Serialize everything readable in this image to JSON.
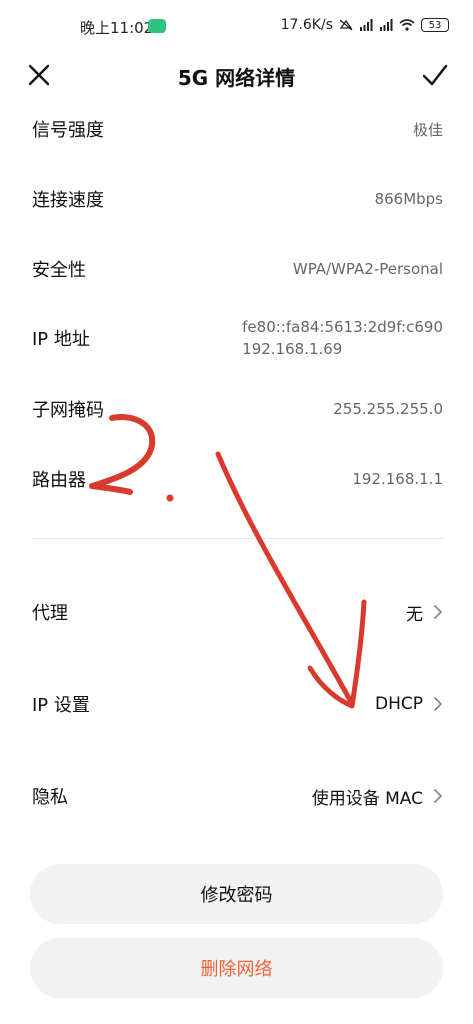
{
  "status_bar": {
    "time": "晚上11:02",
    "speed": "17.6K/s",
    "battery": "53",
    "badge_icon": "app-notification-icon",
    "icons": [
      "mute-icon",
      "hd-signal-icon",
      "hd-signal-icon",
      "wifi-icon",
      "battery-icon"
    ]
  },
  "header": {
    "title": "5G 网络详情",
    "close_icon": "close-icon",
    "confirm_icon": "checkmark-icon"
  },
  "details": {
    "signal": {
      "label": "信号强度",
      "value": "极佳"
    },
    "speed": {
      "label": "连接速度",
      "value": "866Mbps"
    },
    "security": {
      "label": "安全性",
      "value": "WPA/WPA2-Personal"
    },
    "ip": {
      "label": "IP 地址",
      "ipv6": "fe80::fa84:5613:2d9f:c690",
      "ipv4": "192.168.1.69"
    },
    "subnet": {
      "label": "子网掩码",
      "value": "255.255.255.0"
    },
    "router": {
      "label": "路由器",
      "value": "192.168.1.1"
    }
  },
  "settings": {
    "proxy": {
      "label": "代理",
      "value": "无"
    },
    "ip_settings": {
      "label": "IP 设置",
      "value": "DHCP"
    },
    "privacy": {
      "label": "隐私",
      "value": "使用设备 MAC"
    }
  },
  "buttons": {
    "change_password": "修改密码",
    "delete_network": "删除网络"
  },
  "colors": {
    "accent_delete": "#f06236",
    "annotation_red": "#d93a2b",
    "button_bg": "#f2f2f2"
  }
}
